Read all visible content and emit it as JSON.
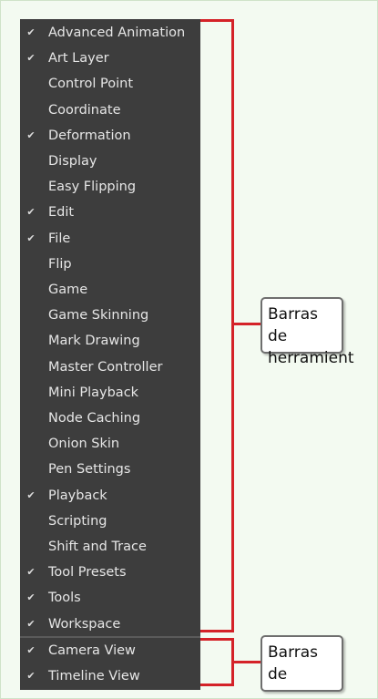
{
  "menu": {
    "items": [
      {
        "label": "Advanced Animation",
        "checked": true
      },
      {
        "label": "Art Layer",
        "checked": true
      },
      {
        "label": "Control Point",
        "checked": false
      },
      {
        "label": "Coordinate",
        "checked": false
      },
      {
        "label": "Deformation",
        "checked": true
      },
      {
        "label": "Display",
        "checked": false
      },
      {
        "label": "Easy Flipping",
        "checked": false
      },
      {
        "label": "Edit",
        "checked": true
      },
      {
        "label": "File",
        "checked": true
      },
      {
        "label": "Flip",
        "checked": false
      },
      {
        "label": "Game",
        "checked": false
      },
      {
        "label": "Game Skinning",
        "checked": false
      },
      {
        "label": "Mark Drawing",
        "checked": false
      },
      {
        "label": "Master Controller",
        "checked": false
      },
      {
        "label": "Mini Playback",
        "checked": false
      },
      {
        "label": "Node Caching",
        "checked": false
      },
      {
        "label": "Onion Skin",
        "checked": false
      },
      {
        "label": "Pen Settings",
        "checked": false
      },
      {
        "label": "Playback",
        "checked": true
      },
      {
        "label": "Scripting",
        "checked": false
      },
      {
        "label": "Shift and Trace",
        "checked": false
      },
      {
        "label": "Tool Presets",
        "checked": true
      },
      {
        "label": "Tools",
        "checked": true
      },
      {
        "label": "Workspace",
        "checked": true
      }
    ],
    "view_items": [
      {
        "label": "Camera View",
        "checked": true
      },
      {
        "label": "Timeline View",
        "checked": true
      }
    ],
    "check_glyph": "✔"
  },
  "callouts": {
    "toolbars_label": "Barras de herramient",
    "views_label": "Barras de"
  },
  "colors": {
    "menu_bg": "#3d3d3d",
    "bracket": "#d42228",
    "page_bg": "#f3faf1"
  }
}
